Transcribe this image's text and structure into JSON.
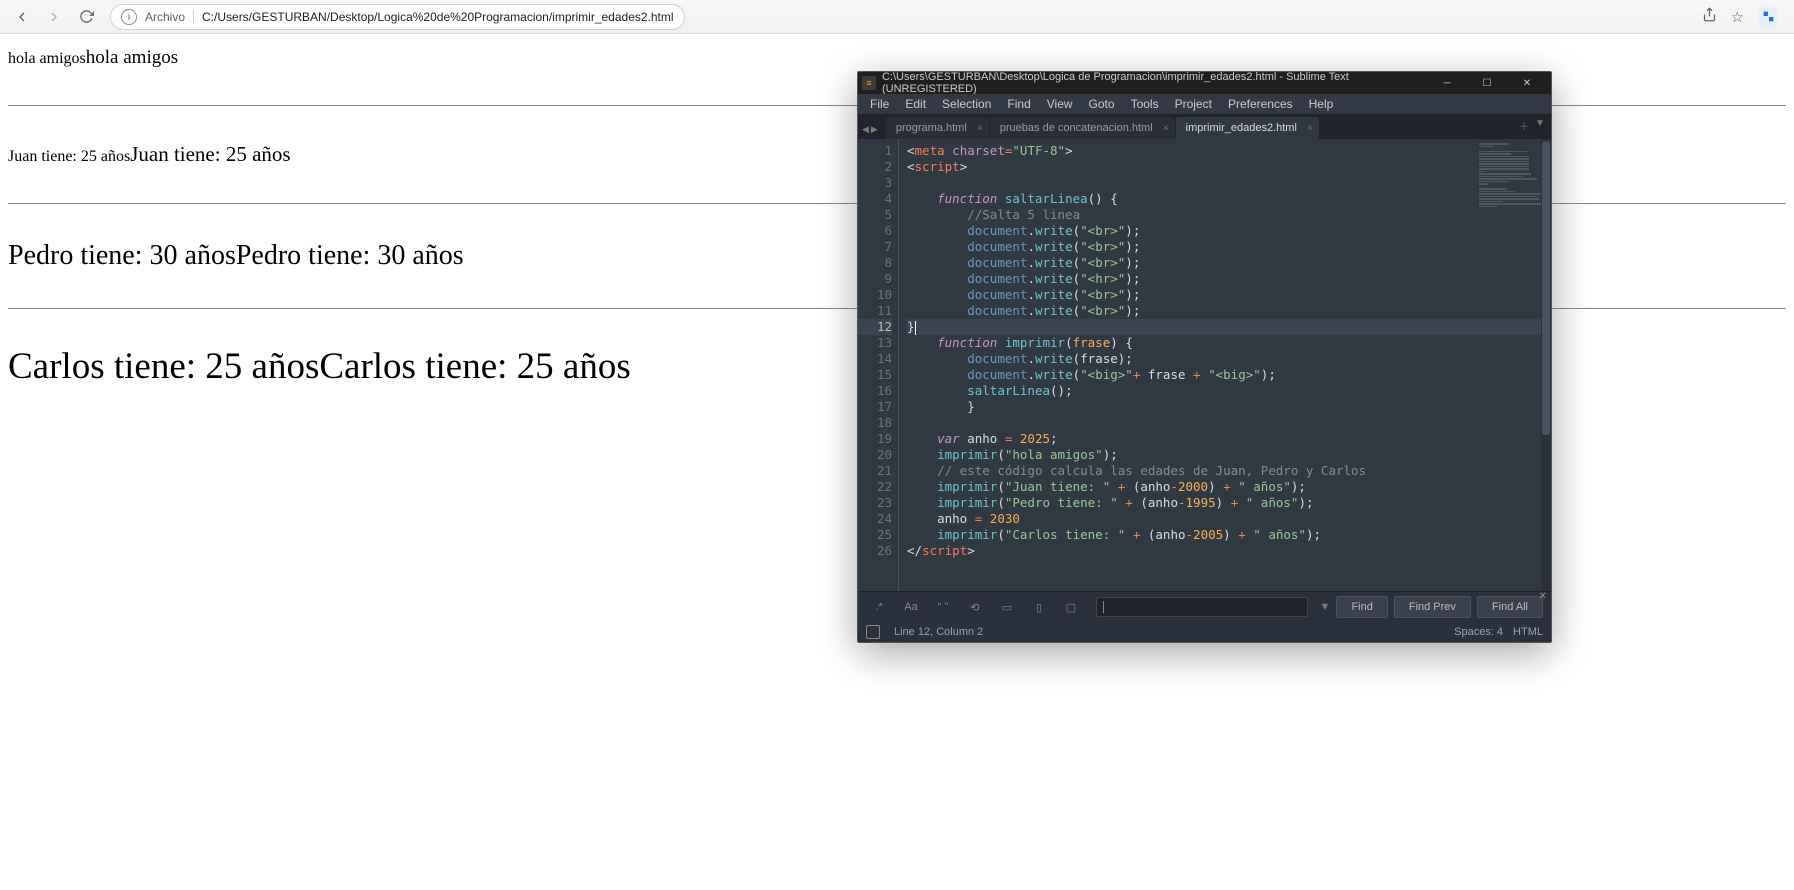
{
  "browser": {
    "file_label": "Archivo",
    "url": "C:/Users/GESTURBAN/Desktop/Logica%20de%20Programacion/imprimir_edades2.html"
  },
  "page_output": {
    "l1a": "hola amigos",
    "l1b": "hola amigos",
    "l2a": "Juan tiene: 25 años",
    "l2b": "Juan tiene: 25 años",
    "l3a": "Pedro tiene: 30 años",
    "l3b": "Pedro tiene: 30 años",
    "l4a": "Carlos tiene: 25 años",
    "l4b": "Carlos tiene: 25 años"
  },
  "sublime": {
    "title": "C:\\Users\\GESTURBAN\\Desktop\\Logica de Programacion\\imprimir_edades2.html - Sublime Text (UNREGISTERED)",
    "menu": [
      "File",
      "Edit",
      "Selection",
      "Find",
      "View",
      "Goto",
      "Tools",
      "Project",
      "Preferences",
      "Help"
    ],
    "tabs": [
      {
        "label": "programa.html",
        "active": false
      },
      {
        "label": "pruebas de concatenacion.html",
        "active": false
      },
      {
        "label": "imprimir_edades2.html",
        "active": true
      }
    ],
    "find": {
      "placeholder": "",
      "buttons": {
        "find": "Find",
        "prev": "Find Prev",
        "all": "Find All"
      }
    },
    "status": {
      "pos": "Line 12, Column 2",
      "spaces": "Spaces: 4",
      "syntax": "HTML"
    },
    "gutter_lines": 26,
    "current_line": 12
  }
}
